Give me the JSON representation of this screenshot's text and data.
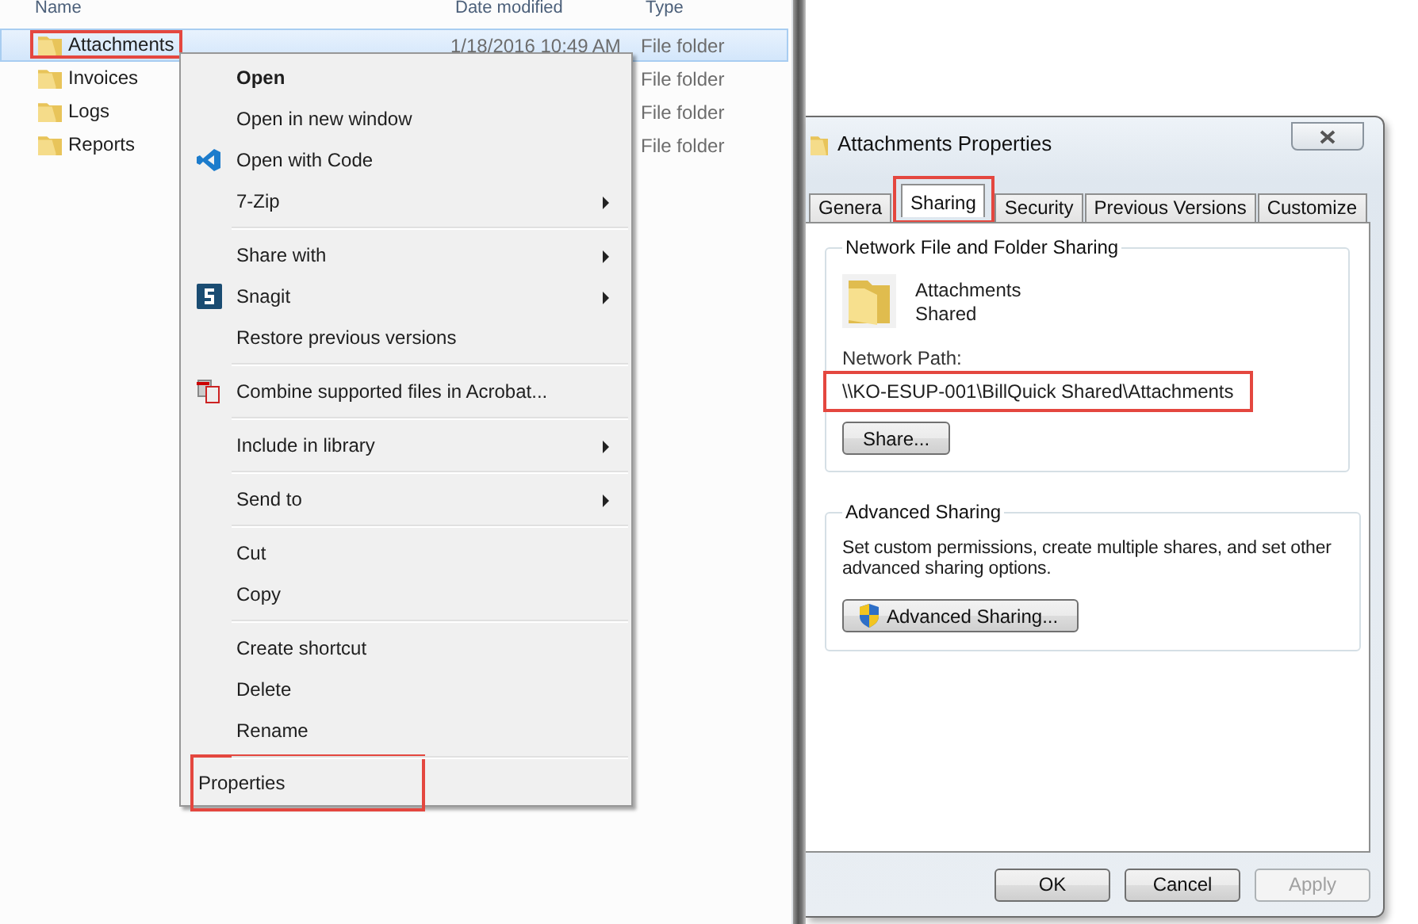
{
  "explorer": {
    "columns": [
      "Name",
      "Date modified",
      "Type"
    ],
    "rows": [
      {
        "name": "Attachments",
        "date": "1/18/2016 10:49 AM",
        "type": "File folder",
        "selected": true,
        "highlighted": true
      },
      {
        "name": "Invoices",
        "type": "File folder",
        "selected": false,
        "highlighted": false
      },
      {
        "name": "Logs",
        "type": "File folder",
        "selected": false,
        "highlighted": false
      },
      {
        "name": "Reports",
        "type": "File folder",
        "selected": false,
        "highlighted": false
      }
    ]
  },
  "context_menu": {
    "items": [
      {
        "kind": "item",
        "label": "Open",
        "default": true,
        "submenu": false,
        "highlighted": false
      },
      {
        "kind": "item",
        "label": "Open in new window",
        "default": false,
        "submenu": false,
        "highlighted": false
      },
      {
        "kind": "item",
        "label": "Open with Code",
        "default": false,
        "submenu": false,
        "highlighted": false
      },
      {
        "kind": "item",
        "label": "7-Zip",
        "default": false,
        "submenu": true,
        "highlighted": false
      },
      {
        "kind": "separator"
      },
      {
        "kind": "item",
        "label": "Share with",
        "default": false,
        "submenu": true,
        "highlighted": false
      },
      {
        "kind": "item",
        "label": "Snagit",
        "default": false,
        "submenu": true,
        "highlighted": false
      },
      {
        "kind": "item",
        "label": "Restore previous versions",
        "default": false,
        "submenu": false,
        "highlighted": false
      },
      {
        "kind": "separator"
      },
      {
        "kind": "item",
        "label": "Combine supported files in Acrobat...",
        "default": false,
        "submenu": false,
        "highlighted": false
      },
      {
        "kind": "separator"
      },
      {
        "kind": "item",
        "label": "Include in library",
        "default": false,
        "submenu": true,
        "highlighted": false
      },
      {
        "kind": "separator"
      },
      {
        "kind": "item",
        "label": "Send to",
        "default": false,
        "submenu": true,
        "highlighted": false
      },
      {
        "kind": "separator"
      },
      {
        "kind": "item",
        "label": "Cut",
        "default": false,
        "submenu": false,
        "highlighted": false
      },
      {
        "kind": "item",
        "label": "Copy",
        "default": false,
        "submenu": false,
        "highlighted": false
      },
      {
        "kind": "separator"
      },
      {
        "kind": "item",
        "label": "Create shortcut",
        "default": false,
        "submenu": false,
        "highlighted": false
      },
      {
        "kind": "item",
        "label": "Delete",
        "default": false,
        "submenu": false,
        "highlighted": false
      },
      {
        "kind": "item",
        "label": "Rename",
        "default": false,
        "submenu": false,
        "highlighted": false
      },
      {
        "kind": "separator"
      },
      {
        "kind": "item",
        "label": "Properties",
        "default": false,
        "submenu": false,
        "highlighted": true
      }
    ]
  },
  "dialog": {
    "title": "Attachments Properties",
    "tabs": [
      {
        "label": "Genera",
        "selected": false,
        "highlighted": false
      },
      {
        "label": "Sharing",
        "selected": true,
        "highlighted": true
      },
      {
        "label": "Security",
        "selected": false,
        "highlighted": false
      },
      {
        "label": "Previous Versions",
        "selected": false,
        "highlighted": false
      },
      {
        "label": "Customize",
        "selected": false,
        "highlighted": false
      }
    ],
    "network_sharing": {
      "heading": "Network File and Folder Sharing",
      "folder_name": "Attachments",
      "status": "Shared",
      "path_label": "Network Path:",
      "path": "\\\\KO-ESUP-001\\BillQuick Shared\\Attachments",
      "path_highlighted": true,
      "button": "Share..."
    },
    "advanced_sharing": {
      "heading": "Advanced Sharing",
      "description": "Set custom permissions, create multiple shares, and set other advanced sharing options.",
      "button": "Advanced Sharing..."
    },
    "buttons": [
      {
        "label": "OK",
        "disabled": false
      },
      {
        "label": "Cancel",
        "disabled": false
      },
      {
        "label": "Apply",
        "disabled": true
      }
    ]
  }
}
